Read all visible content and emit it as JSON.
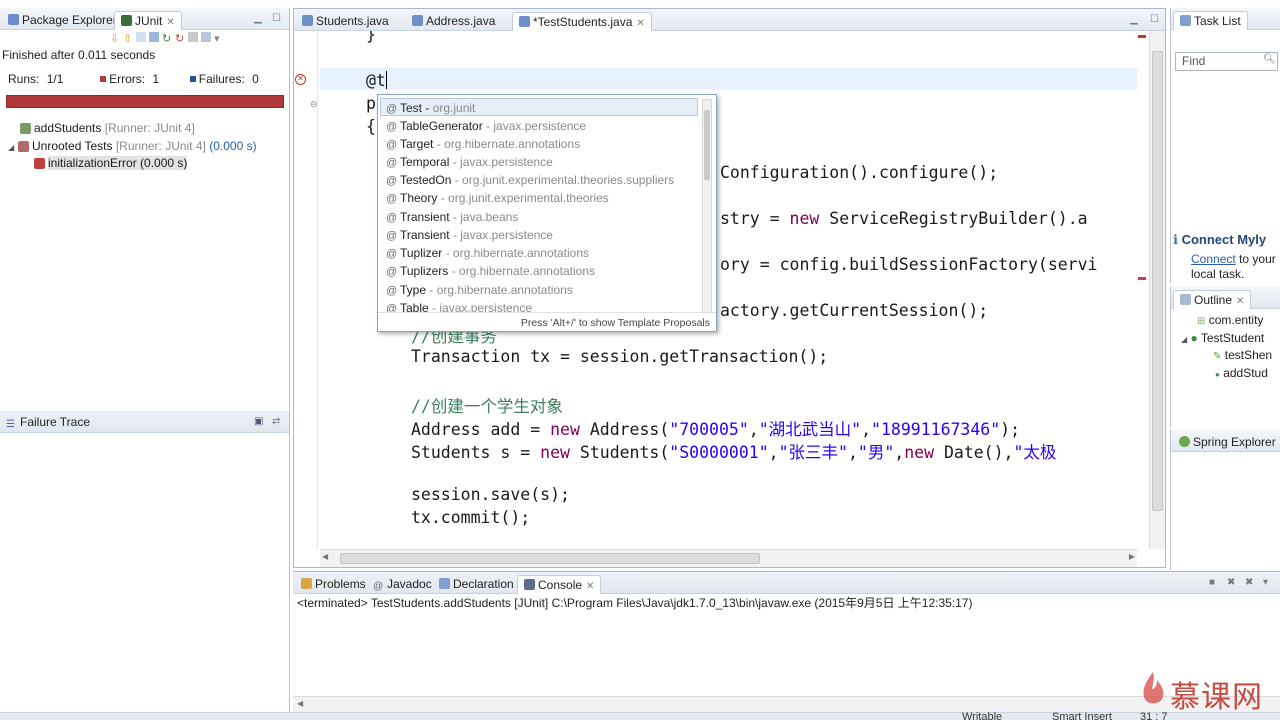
{
  "junit_view": {
    "tabs": [
      {
        "label": "Package Explorer"
      },
      {
        "label": "JUnit"
      }
    ],
    "finished": "Finished after 0.011 seconds",
    "runs_label": "Runs:",
    "runs_value": "1/1",
    "errors_label": "Errors:",
    "errors_value": "1",
    "failures_label": "Failures:",
    "failures_value": "0",
    "progress": 1.0,
    "progress_color": "#b03a3a",
    "tree": [
      {
        "label": "addStudents",
        "detail": "[Runner: JUnit 4]",
        "time": ""
      },
      {
        "label": "Unrooted Tests",
        "detail": "[Runner: JUnit 4]",
        "time": "(0.000 s)"
      },
      {
        "label": "initializationError (0.000 s)",
        "detail": "",
        "time": ""
      }
    ]
  },
  "failure_trace": {
    "title": "Failure Trace"
  },
  "editor": {
    "tabs": [
      {
        "label": "Students.java"
      },
      {
        "label": "Address.java"
      },
      {
        "label": "*TestStudents.java"
      }
    ],
    "lines": {
      "l0": "}",
      "l1": "@t",
      "l2": "p",
      "l3": "{",
      "l4_tail": "Configuration().configure();",
      "l5_tail_a": "stry = ",
      "l5_kw": "new",
      "l5_tail_b": " ServiceRegistryBuilder().a",
      "l6_tail": "ory = config.buildSessionFactory(servi",
      "l7_tail": "actory.getCurrentSession();",
      "l8_comment": "//创建事务",
      "l9": "Transaction tx = session.getTransaction();",
      "l10_comment": "//创建一个学生对象",
      "l11_a": "Address add = ",
      "l11_kw": "new",
      "l11_b": " Address(",
      "l11_s1": "\"700005\"",
      "l11_c1": ",",
      "l11_s2": "\"湖北武当山\"",
      "l11_c2": ",",
      "l11_s3": "\"18991167346\"",
      "l11_end": ");",
      "l12_a": "Students s = ",
      "l12_kw": "new",
      "l12_b": " Students(",
      "l12_s1": "\"S0000001\"",
      "l12_c1": ",",
      "l12_s2": "\"张三丰\"",
      "l12_c2": ",",
      "l12_s3": "\"男\"",
      "l12_c3": ",",
      "l12_kw2": "new",
      "l12_d": " Date(),",
      "l12_s4": "\"太极",
      "l13": "session.save(s);",
      "l14": "tx.commit();"
    },
    "colors": {
      "keyword": "#7f0055",
      "string": "#2a00ff",
      "comment": "#3f7f5f",
      "current_line": "#e8f2fe"
    }
  },
  "content_assist": {
    "items": [
      {
        "name": "Test",
        "pkg": "org.junit"
      },
      {
        "name": "TableGenerator",
        "pkg": "javax.persistence"
      },
      {
        "name": "Target",
        "pkg": "org.hibernate.annotations"
      },
      {
        "name": "Temporal",
        "pkg": "javax.persistence"
      },
      {
        "name": "TestedOn",
        "pkg": "org.junit.experimental.theories.suppliers"
      },
      {
        "name": "Theory",
        "pkg": "org.junit.experimental.theories"
      },
      {
        "name": "Transient",
        "pkg": "java.beans"
      },
      {
        "name": "Transient",
        "pkg": "javax.persistence"
      },
      {
        "name": "Tuplizer",
        "pkg": "org.hibernate.annotations"
      },
      {
        "name": "Tuplizers",
        "pkg": "org.hibernate.annotations"
      },
      {
        "name": "Type",
        "pkg": "org.hibernate.annotations"
      },
      {
        "name": "Table",
        "pkg": "javax.persistence"
      }
    ],
    "hint": "Press 'Alt+/' to show Template Proposals"
  },
  "task_list": {
    "title": "Task List",
    "find_placeholder": "Find",
    "mylyn_title": "Connect Myly",
    "mylyn_link": "Connect",
    "mylyn_text_a": "to your",
    "mylyn_text_b": "local task."
  },
  "outline": {
    "title": "Outline",
    "items": [
      {
        "label": "com.entity"
      },
      {
        "label": "TestStudent"
      },
      {
        "label": "testShen"
      },
      {
        "label": "addStud"
      }
    ]
  },
  "spring": {
    "title": "Spring Explorer"
  },
  "console": {
    "tabs": [
      {
        "label": "Problems"
      },
      {
        "label": "Javadoc"
      },
      {
        "label": "Declaration"
      },
      {
        "label": "Console"
      }
    ],
    "line": "<terminated> TestStudents.addStudents [JUnit] C:\\Program Files\\Java\\jdk1.7.0_13\\bin\\javaw.exe (2015年9月5日 上午12:35:17)"
  },
  "statusbar": {
    "writable": "Writable",
    "insert": "Smart Insert",
    "position": "31 : 7"
  },
  "watermark": {
    "text": "慕课网"
  }
}
